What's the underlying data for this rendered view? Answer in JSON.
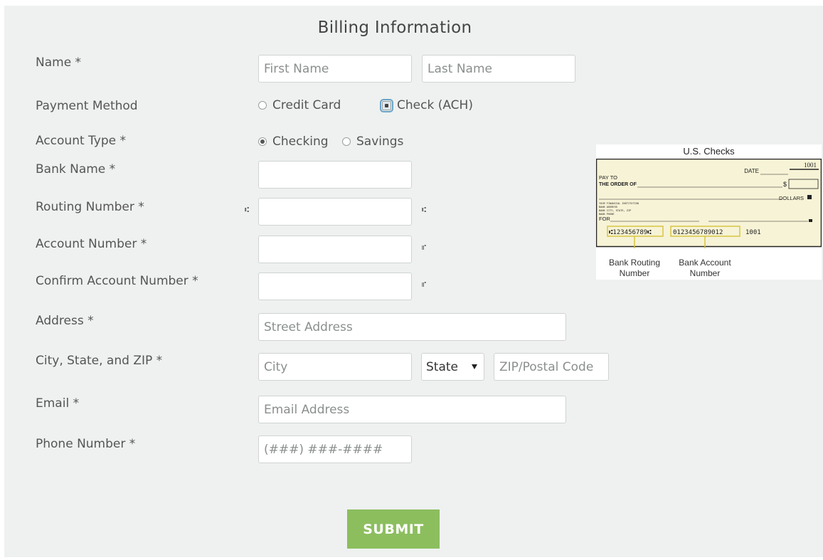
{
  "form": {
    "title": "Billing Information",
    "labels": {
      "name": "Name  *",
      "payment_method": "Payment Method",
      "account_type": "Account Type  *",
      "bank_name": "Bank Name  *",
      "routing_number": "Routing Number  *",
      "account_number": "Account Number  *",
      "confirm_account_number": "Confirm Account Number  *",
      "address": "Address  *",
      "city_state_zip": "City, State, and ZIP  *",
      "email": "Email  *",
      "phone": "Phone Number  *"
    },
    "placeholders": {
      "first_name": "First Name",
      "last_name": "Last Name",
      "street": "Street Address",
      "city": "City",
      "zip": "ZIP/Postal Code",
      "email": "Email Address",
      "phone": "(###) ###-####"
    },
    "payment_method": {
      "options": [
        "Credit Card",
        "Check (ACH)"
      ],
      "selected": "Check (ACH)"
    },
    "account_type": {
      "options": [
        "Checking",
        "Savings"
      ],
      "selected": "Checking"
    },
    "state_select": {
      "value": "State"
    },
    "micr_symbols": {
      "transit": "⑆",
      "on_us": "⑈"
    },
    "submit_label": "SUBMIT"
  },
  "check_illustration": {
    "caption": "U.S. Checks",
    "check_number": "1001",
    "date_label": "DATE",
    "pay_to_line1": "PAY TO",
    "pay_to_line2": "THE ORDER OF",
    "dollar_sign": "$",
    "dollars_label": "DOLLARS",
    "bank_lines": [
      "YOUR FINANCIAL INSTITUTION",
      "BANK ADDRESS",
      "BANK CITY, STATE, ZIP",
      "BANK PHONE"
    ],
    "for_label": "FOR",
    "micr_routing": "⑆123456789⑆",
    "micr_account": "0123456789012",
    "micr_check": "1001",
    "routing_note": [
      "Bank Routing",
      "Number"
    ],
    "account_note": [
      "Bank Account",
      "Number"
    ]
  }
}
